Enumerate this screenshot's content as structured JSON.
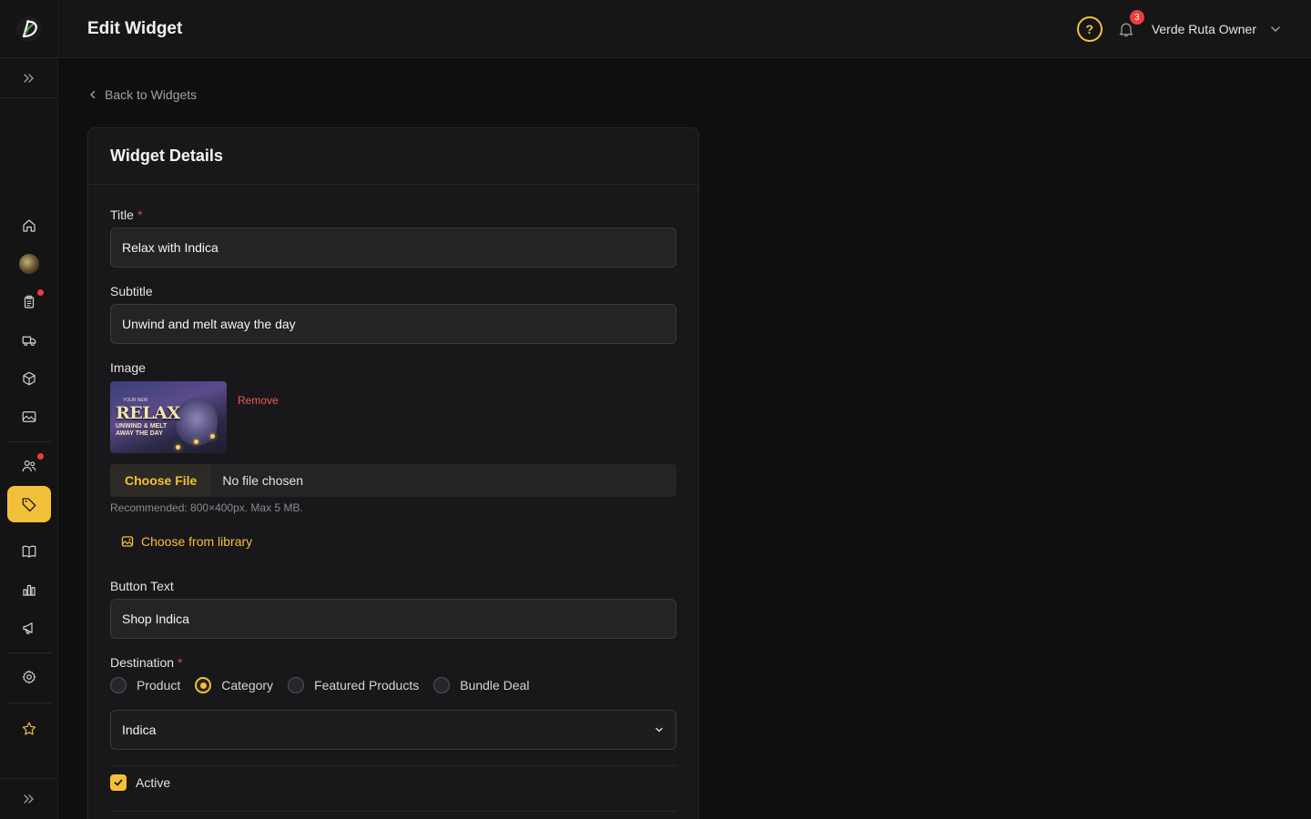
{
  "header": {
    "title": "Edit Widget",
    "notification_count": "3",
    "user_name": "Verde Ruta Owner",
    "help_glyph": "?"
  },
  "sidebar": {
    "items": [
      {
        "name": "home-icon"
      },
      {
        "name": "store-avatar"
      },
      {
        "name": "orders-icon",
        "has_dot": true
      },
      {
        "name": "delivery-truck-icon"
      },
      {
        "name": "products-box-icon"
      },
      {
        "name": "media-image-icon"
      },
      {
        "name": "customers-icon",
        "has_dot": true
      },
      {
        "name": "promotions-tag-icon",
        "active": true
      },
      {
        "name": "catalog-book-icon"
      },
      {
        "name": "analytics-chart-icon"
      },
      {
        "name": "marketing-megaphone-icon"
      },
      {
        "name": "settings-gear-icon"
      },
      {
        "name": "favorites-star-icon"
      }
    ]
  },
  "breadcrumb": {
    "back_label": "Back to Widgets"
  },
  "form": {
    "card_title": "Widget Details",
    "title_label": "Title",
    "title_value": "Relax with Indica",
    "subtitle_label": "Subtitle",
    "subtitle_value": "Unwind and melt away the day",
    "image_label": "Image",
    "remove_label": "Remove",
    "thumb_top": "YOUR NEW",
    "thumb_main": "RELAX",
    "thumb_line1": "UNWIND & MELT",
    "thumb_line2": "AWAY THE DAY",
    "file_button": "Choose File",
    "file_status": "No file chosen",
    "file_hint": "Recommended: 800×400px. Max 5 MB.",
    "library_button": "Choose from library",
    "button_text_label": "Button Text",
    "button_text_value": "Shop Indica",
    "destination_label": "Destination",
    "destination_options": [
      "Product",
      "Category",
      "Featured Products",
      "Bundle Deal"
    ],
    "destination_selected": "Category",
    "category_selected": "Indica",
    "active_label": "Active",
    "active_checked": true
  },
  "colors": {
    "accent": "#f3c03a",
    "danger": "#ef3b3b",
    "background": "#0f0f10",
    "card": "#18181a"
  }
}
